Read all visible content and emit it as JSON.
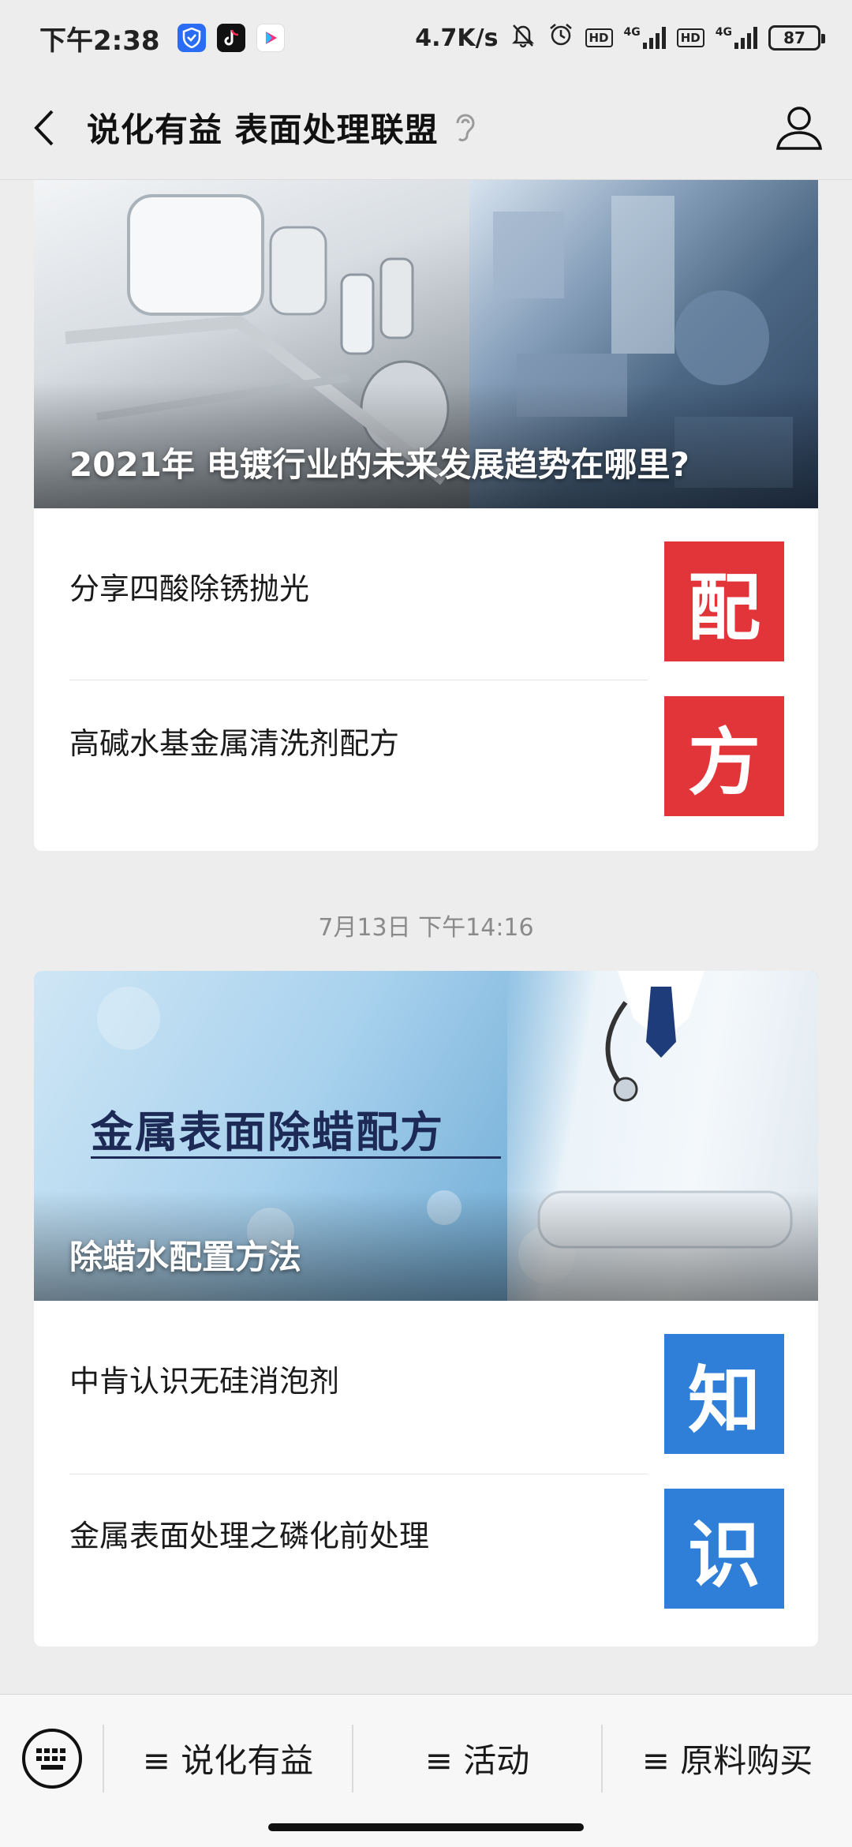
{
  "status_bar": {
    "time": "下午2:38",
    "net_speed": "4.7K/s",
    "network_1": "4G",
    "network_2": "4G",
    "hd_1": "HD",
    "hd_2": "HD",
    "battery": "87",
    "icons": [
      "shield-app-icon",
      "tiktok-app-icon",
      "youku-app-icon",
      "mute-icon",
      "alarm-icon"
    ]
  },
  "header": {
    "title": "说化有益 表面处理联盟"
  },
  "articles": [
    {
      "hero_caption": "2021年 电镀行业的未来发展趋势在哪里?",
      "items": [
        {
          "title": "分享四酸除锈抛光",
          "thumb_char": "配",
          "thumb_color": "#e2353a"
        },
        {
          "title": "高碱水基金属清洗剂配方",
          "thumb_char": "方",
          "thumb_color": "#e2353a"
        }
      ]
    },
    {
      "hero_overlay": "金属表面除蜡配方",
      "hero_caption": "除蜡水配置方法",
      "items": [
        {
          "title": "中肯认识无硅消泡剂",
          "thumb_char": "知",
          "thumb_color": "#2f7fd9"
        },
        {
          "title": "金属表面处理之磷化前处理",
          "thumb_char": "识",
          "thumb_color": "#2f7fd9"
        }
      ]
    }
  ],
  "timestamp": "7月13日 下午14:16",
  "bottom_menu": {
    "items": [
      "≡ 说化有益",
      "≡ 活动",
      "≡ 原料购买"
    ]
  }
}
